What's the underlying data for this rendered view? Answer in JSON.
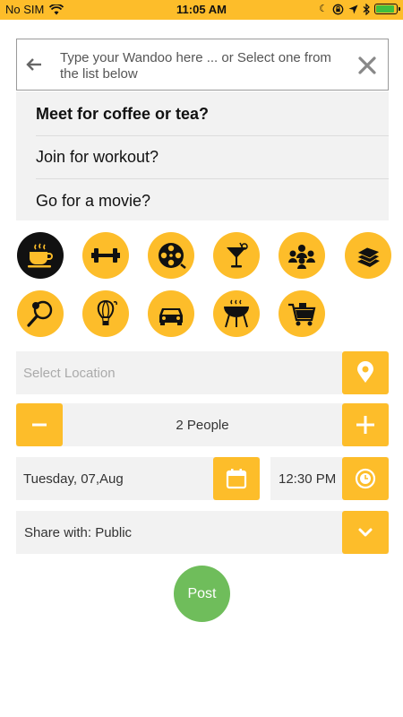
{
  "status_bar": {
    "carrier": "No SIM",
    "time": "11:05 AM",
    "icons": [
      "wifi-icon",
      "moon-icon",
      "lock-rotation-icon",
      "location-arrow-icon",
      "bluetooth-icon",
      "battery-icon"
    ],
    "battery_level": 0.9
  },
  "search": {
    "placeholder": "Type your Wandoo here ... or Select one from the list below",
    "back_icon": "back-arrow-icon",
    "clear_icon": "close-icon"
  },
  "suggestions": [
    {
      "label": "Meet for coffee or tea?"
    },
    {
      "label": "Join for workout?"
    },
    {
      "label": "Go for a movie?"
    }
  ],
  "categories": [
    {
      "icon": "coffee-cup-icon",
      "active": true
    },
    {
      "icon": "dumbbell-icon",
      "active": false
    },
    {
      "icon": "film-reel-icon",
      "active": false
    },
    {
      "icon": "cocktail-icon",
      "active": false
    },
    {
      "icon": "group-icon",
      "active": false
    },
    {
      "icon": "books-icon",
      "active": false
    },
    {
      "icon": "tennis-icon",
      "active": false
    },
    {
      "icon": "hot-air-balloon-icon",
      "active": false
    },
    {
      "icon": "car-icon",
      "active": false
    },
    {
      "icon": "barbecue-grill-icon",
      "active": false
    },
    {
      "icon": "shopping-cart-icon",
      "active": false
    }
  ],
  "location": {
    "placeholder": "Select Location",
    "icon": "location-pin-icon"
  },
  "people": {
    "label": "2 People",
    "minus_icon": "minus-icon",
    "plus_icon": "plus-icon"
  },
  "date": {
    "value": "Tuesday, 07,Aug",
    "icon": "calendar-icon"
  },
  "time": {
    "value": "12:30 PM",
    "icon": "clock-icon"
  },
  "share": {
    "label": "Share with: Public",
    "icon": "chevron-down-icon"
  },
  "post_label": "Post",
  "colors": {
    "accent": "#fdbd2a",
    "post": "#6fbd5b",
    "field_bg": "#f2f2f2",
    "active_category": "#111111"
  }
}
